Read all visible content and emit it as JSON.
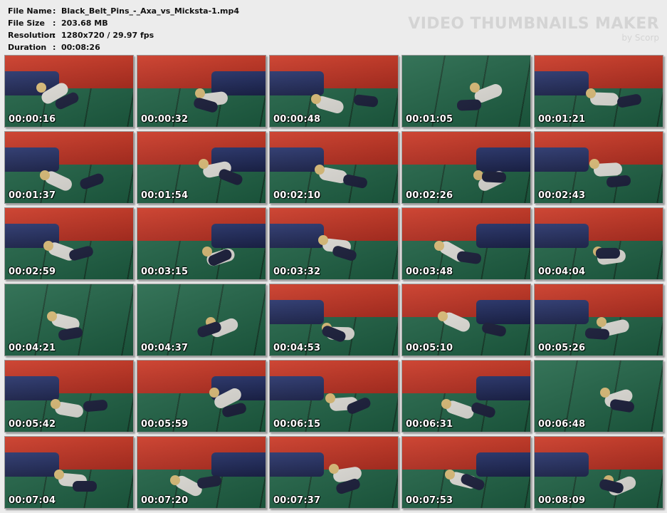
{
  "meta": {
    "file_name_label": "File Name",
    "file_name": "Black_Belt_Pins_-_Axa_vs_Micksta-1.mp4",
    "file_size_label": "File Size",
    "file_size": "203.68 MB",
    "resolution_label": "Resolution",
    "resolution": "1280x720 / 29.97 fps",
    "duration_label": "Duration",
    "duration": "00:08:26",
    "separator": ":"
  },
  "brand": {
    "title": "VIDEO THUMBNAILS MAKER",
    "subtitle": "by Scorp"
  },
  "thumbnails": [
    {
      "time": "00:00:16",
      "scene": "wall"
    },
    {
      "time": "00:00:32",
      "scene": "wall"
    },
    {
      "time": "00:00:48",
      "scene": "wall"
    },
    {
      "time": "00:01:05",
      "scene": "mat"
    },
    {
      "time": "00:01:21",
      "scene": "wall"
    },
    {
      "time": "00:01:37",
      "scene": "wall"
    },
    {
      "time": "00:01:54",
      "scene": "wall"
    },
    {
      "time": "00:02:10",
      "scene": "wall"
    },
    {
      "time": "00:02:26",
      "scene": "wall"
    },
    {
      "time": "00:02:43",
      "scene": "wall"
    },
    {
      "time": "00:02:59",
      "scene": "wall"
    },
    {
      "time": "00:03:15",
      "scene": "wall"
    },
    {
      "time": "00:03:32",
      "scene": "wall"
    },
    {
      "time": "00:03:48",
      "scene": "wall"
    },
    {
      "time": "00:04:04",
      "scene": "wall"
    },
    {
      "time": "00:04:21",
      "scene": "mat"
    },
    {
      "time": "00:04:37",
      "scene": "mat"
    },
    {
      "time": "00:04:53",
      "scene": "wall"
    },
    {
      "time": "00:05:10",
      "scene": "wall"
    },
    {
      "time": "00:05:26",
      "scene": "wall"
    },
    {
      "time": "00:05:42",
      "scene": "wall"
    },
    {
      "time": "00:05:59",
      "scene": "wall"
    },
    {
      "time": "00:06:15",
      "scene": "wall"
    },
    {
      "time": "00:06:31",
      "scene": "wall"
    },
    {
      "time": "00:06:48",
      "scene": "mat"
    },
    {
      "time": "00:07:04",
      "scene": "wall"
    },
    {
      "time": "00:07:20",
      "scene": "wall"
    },
    {
      "time": "00:07:37",
      "scene": "wall"
    },
    {
      "time": "00:07:53",
      "scene": "wall"
    },
    {
      "time": "00:08:09",
      "scene": "wall"
    }
  ]
}
